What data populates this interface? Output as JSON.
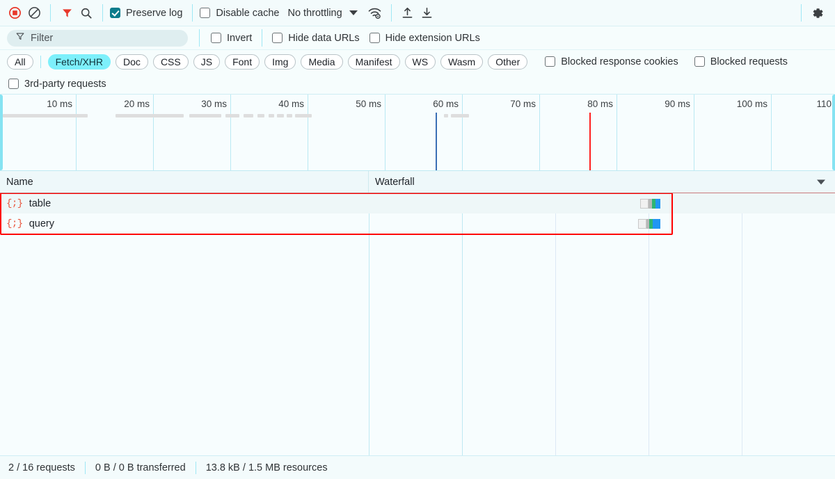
{
  "toolbar": {
    "record_label": "record-stop",
    "clear_label": "clear",
    "filter_toggle_label": "filter",
    "search_label": "search",
    "preserve_log": {
      "label": "Preserve log",
      "checked": true
    },
    "disable_cache": {
      "label": "Disable cache",
      "checked": false
    },
    "throttling": {
      "value": "No throttling"
    },
    "network_conditions_label": "network-conditions",
    "import_label": "import-har",
    "export_label": "export-har",
    "settings_label": "settings"
  },
  "filterbar": {
    "input_value": "",
    "placeholder": "Filter",
    "invert": {
      "label": "Invert",
      "checked": false
    },
    "hide_data_urls": {
      "label": "Hide data URLs",
      "checked": false
    },
    "hide_extension_urls": {
      "label": "Hide extension URLs",
      "checked": false
    }
  },
  "chips": [
    {
      "label": "All",
      "active": false
    },
    {
      "label": "Fetch/XHR",
      "active": true
    },
    {
      "label": "Doc",
      "active": false
    },
    {
      "label": "CSS",
      "active": false
    },
    {
      "label": "JS",
      "active": false
    },
    {
      "label": "Font",
      "active": false
    },
    {
      "label": "Img",
      "active": false
    },
    {
      "label": "Media",
      "active": false
    },
    {
      "label": "Manifest",
      "active": false
    },
    {
      "label": "WS",
      "active": false
    },
    {
      "label": "Wasm",
      "active": false
    },
    {
      "label": "Other",
      "active": false
    }
  ],
  "chip_checkboxes": {
    "blocked_response_cookies": {
      "label": "Blocked response cookies",
      "checked": false
    },
    "blocked_requests": {
      "label": "Blocked requests",
      "checked": false
    }
  },
  "third_party": {
    "label": "3rd-party requests",
    "checked": false
  },
  "overview": {
    "tick_labels": [
      "10 ms",
      "20 ms",
      "30 ms",
      "40 ms",
      "50 ms",
      "60 ms",
      "70 ms",
      "80 ms",
      "90 ms",
      "100 ms",
      "110"
    ],
    "dom_content_loaded_ms": 60,
    "load_ms": 80,
    "dom_content_loaded_color": "#3b6fb5",
    "load_color": "#ff2020"
  },
  "table": {
    "columns": [
      "Name",
      "Waterfall"
    ],
    "rows": [
      {
        "name": "table",
        "icon": "json-icon",
        "type": "fetch"
      },
      {
        "name": "query",
        "icon": "json-icon",
        "type": "fetch"
      }
    ]
  },
  "status": {
    "requests": "2 / 16 requests",
    "transferred": "0 B / 0 B transferred",
    "resources": "13.8 kB / 1.5 MB resources"
  },
  "annotation": {
    "color": "#ff0000"
  }
}
